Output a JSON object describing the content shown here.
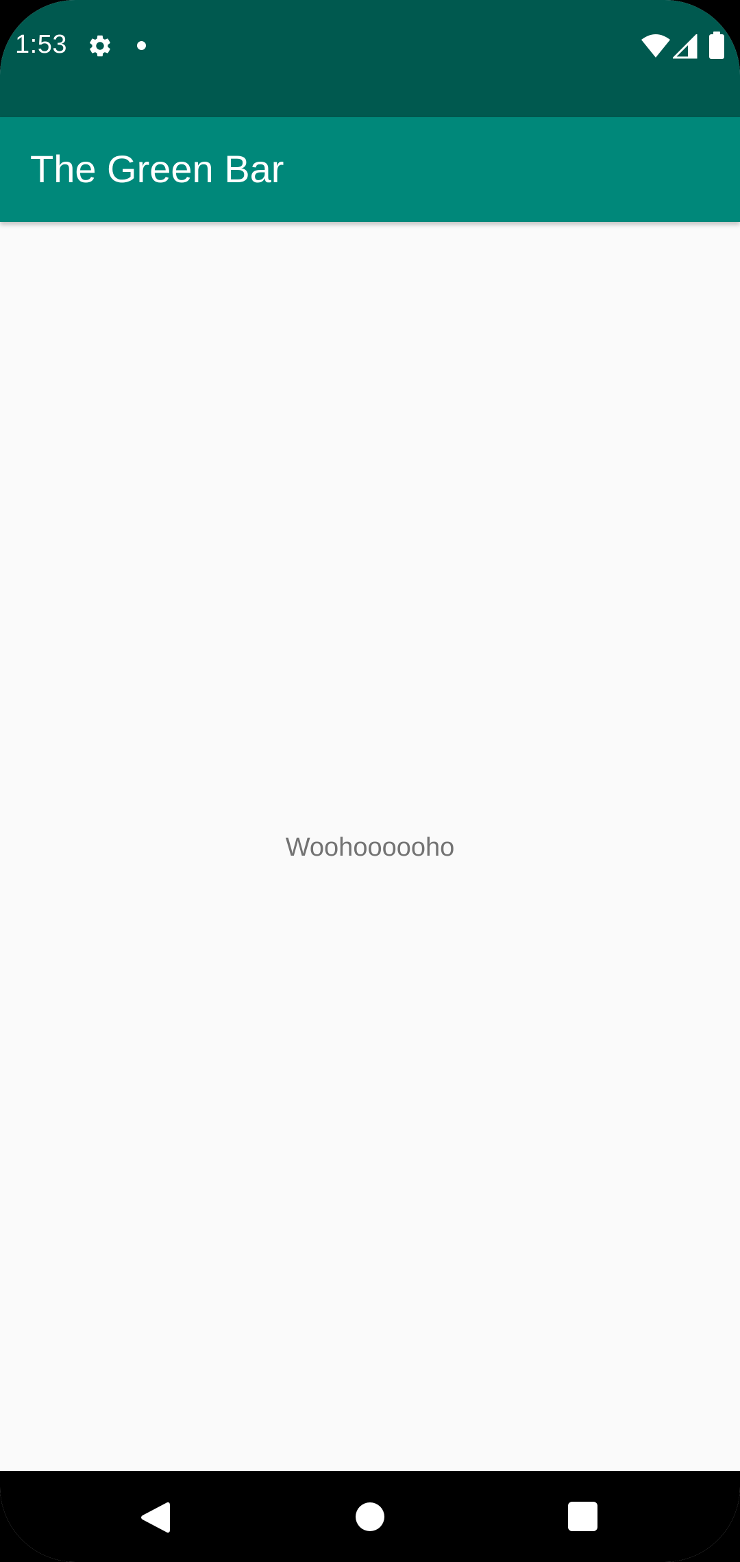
{
  "status_bar": {
    "time": "1:53",
    "icons": [
      "gear-icon",
      "notification-dot-icon",
      "wifi-icon",
      "cellular-signal-icon",
      "battery-icon"
    ],
    "background_color": "#00594f"
  },
  "app_bar": {
    "title": "The Green Bar",
    "background_color": "#00887a"
  },
  "content": {
    "text": "Woohoooooho",
    "background_color": "#fafafa"
  },
  "nav_bar": {
    "buttons": [
      "back-icon",
      "home-icon",
      "recents-icon"
    ]
  }
}
